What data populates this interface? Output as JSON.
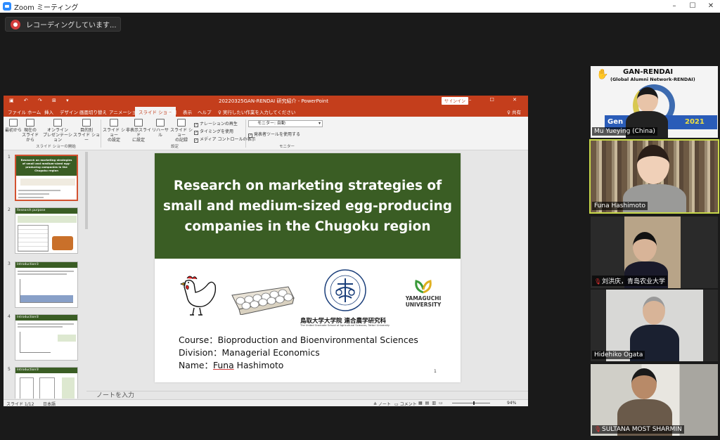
{
  "zoom": {
    "window_title": "Zoom ミーティング",
    "recording_label": "レコーディングしています...",
    "window_controls": [
      "–",
      "☐",
      "✕"
    ]
  },
  "ppt": {
    "doc_title": "20220325GAN-RENDAI 研究紹介 - PowerPoint",
    "signin": "サインイン",
    "quick_access": "▣ ↶ ↷ ⊞ ▾",
    "title_controls": "⊡ – ☐ ✕",
    "tabs": [
      "ファイル",
      "ホーム",
      "挿入",
      "デザイン",
      "画面切り替え",
      "アニメーション",
      "スライド ショー",
      "校閲",
      "表示",
      "ヘルプ"
    ],
    "active_tab": "スライド ショー",
    "tell_me": "♀ 実行したい作業を入力してください",
    "share": "♀ 共有",
    "ribbon": {
      "from_beginning": "最初から",
      "from_current": "現在の\nスライドから",
      "online_present": "オンライン\nプレゼンテーション",
      "custom_show": "目的別\nスライド ショー",
      "group_start": "スライド ショーの開始",
      "setup_show": "スライド ショー\nの設定",
      "hide_slide": "非表示スライド\nに設定",
      "rehearse": "リハーサル",
      "record": "スライド ショー\nの記録",
      "group_setup": "設定",
      "chk_narration": "ナレーションの再生",
      "chk_timing": "タイミングを使用",
      "chk_media": "メディア コントロールの表示",
      "monitor_label": "モニター: 自動",
      "chk_presenter": "発表者ツールを使用する",
      "group_monitor": "モニター"
    },
    "thumbnails": [
      {
        "num": "1",
        "title": "Research on marketing strategies of small and medium-sized egg-producing companies in the Chugoku region"
      },
      {
        "num": "2",
        "title": "Research purpose"
      },
      {
        "num": "3",
        "title": "Introduction①"
      },
      {
        "num": "4",
        "title": "Introduction②"
      },
      {
        "num": "5",
        "title": "Introduction③"
      }
    ],
    "slide": {
      "title": "Research on marketing strategies of small and medium-sized egg-producing companies in the Chugoku region",
      "univ_tottori": "鳥取大学大学院 連合農学研究科",
      "univ_tottori_en": "The United Graduate School of Agricultural Sciences, Tottori University",
      "univ_yamaguchi": "YAMAGUCHI UNIVERSITY",
      "course": "Course：Bioproduction and Bioenvironmental Sciences",
      "division": "Division：Managerial Economics",
      "name_prefix": "Name：",
      "name_first": "Funa",
      "name_last": " Hashimoto",
      "page_num": "1"
    },
    "notes_placeholder": "ノートを入力",
    "status": {
      "slide_pos": "スライド 1/12",
      "language": "日本語",
      "notes": "≜ ノート",
      "comments": "▭ コメント",
      "zoom": "94%"
    }
  },
  "participants": [
    {
      "name": "Mu Yueying (China)",
      "muted": false,
      "active": false,
      "bg_text": "GAN-RENDAI",
      "bg_sub": "(Global Alumni Network-RENDAI)",
      "bg_year": "2021",
      "bg_partial": "Gen"
    },
    {
      "name": "Funa Hashimoto",
      "muted": false,
      "active": true
    },
    {
      "name": "刘洪庆，青岛农业大学",
      "muted": true,
      "active": false
    },
    {
      "name": "Hidehiko Ogata",
      "muted": false,
      "active": false
    },
    {
      "name": "SULTANA MOST SHARMIN",
      "muted": true,
      "active": false
    }
  ],
  "colors": {
    "ppt_accent": "#c43e1c",
    "slide_green": "#3a5d24",
    "active_speaker": "#c8d84a"
  }
}
